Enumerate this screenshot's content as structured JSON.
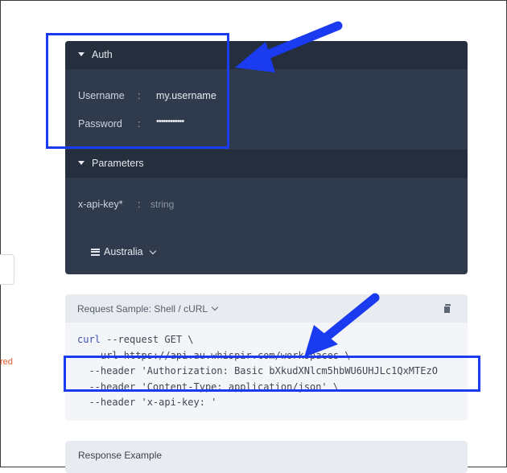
{
  "auth": {
    "title": "Auth",
    "username_label": "Username",
    "username_value": "my.username",
    "password_label": "Password",
    "password_value": "••••••••••••",
    "separator": ":"
  },
  "parameters": {
    "title": "Parameters",
    "api_key_label": "x-api-key*",
    "api_key_placeholder": "string",
    "server_selected": "Australia"
  },
  "request_sample": {
    "title": "Request Sample: Shell / cURL",
    "lines": [
      {
        "cmd": "curl",
        "rest": " --request GET \\"
      },
      {
        "cmd": "",
        "rest": "  --url https://api.au.whispir.com/workspaces \\"
      },
      {
        "cmd": "",
        "rest": "  --header 'Authorization: Basic bXkudXNlcm5hbWU6UHJLc1QxMTEzO"
      },
      {
        "cmd": "",
        "rest": "  --header 'Content-Type: application/json' \\"
      },
      {
        "cmd": "",
        "rest": "  --header 'x-api-key: '"
      }
    ]
  },
  "response_example": {
    "title": "Response Example"
  },
  "sidebar_fragment": {
    "text": "red"
  },
  "colors": {
    "panel_bg": "#2f3b4d",
    "panel_header": "#242e3d",
    "highlight": "#1a3bf0",
    "code_bg": "#f3f5f8"
  }
}
